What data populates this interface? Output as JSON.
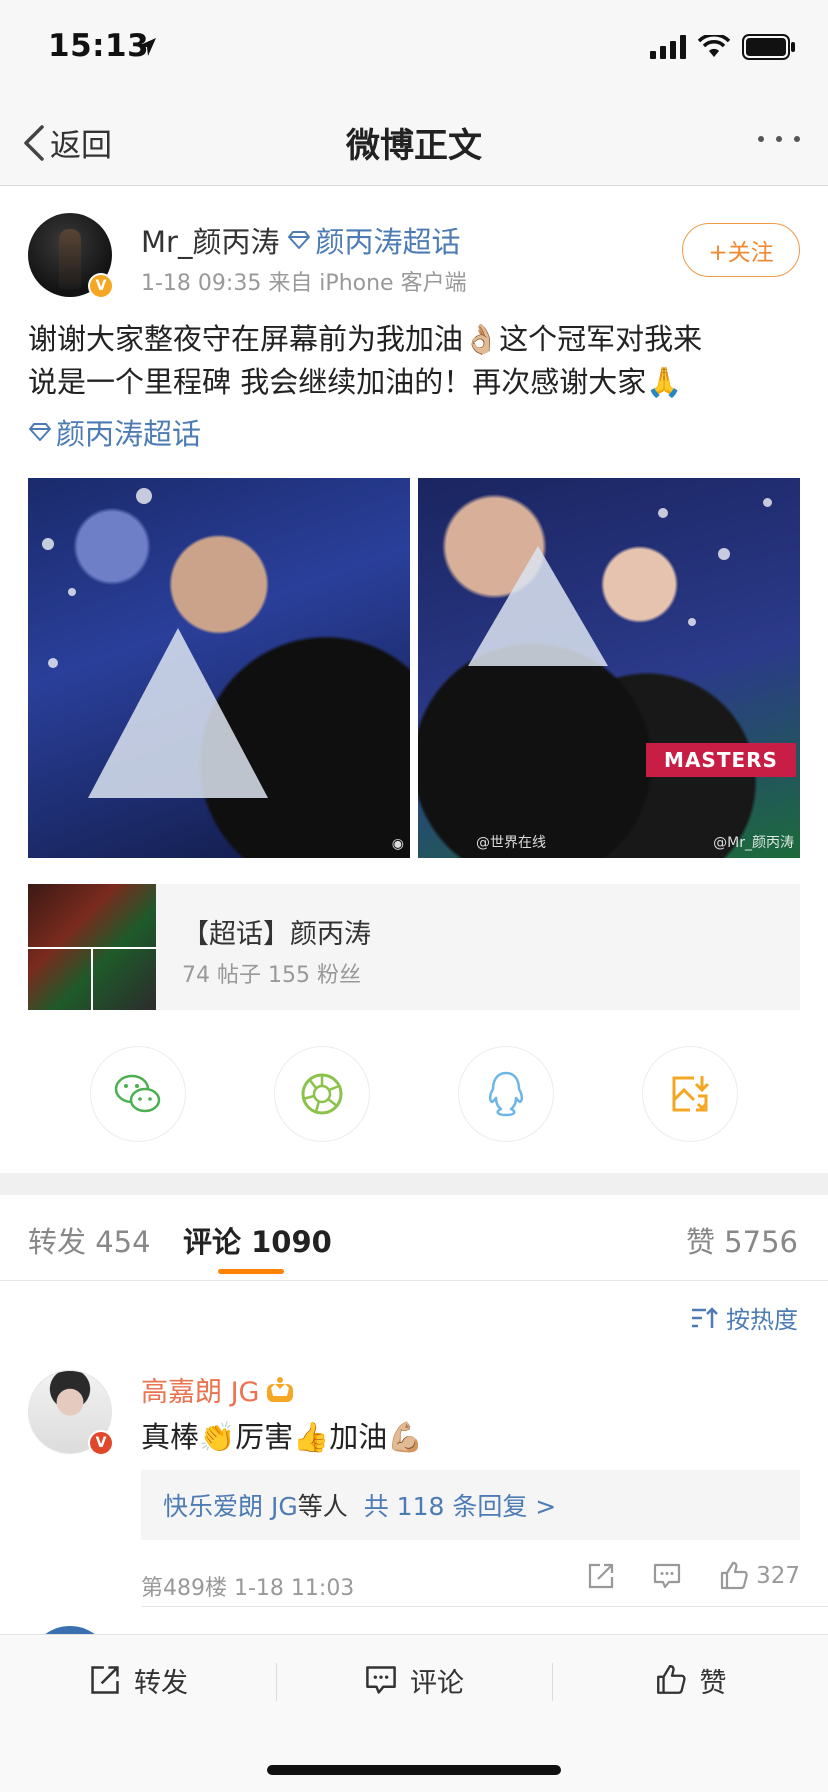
{
  "status_bar": {
    "time": "15:13"
  },
  "nav": {
    "back_label": "返回",
    "title": "微博正文"
  },
  "post": {
    "author": "Mr_颜丙涛",
    "supertopic": "颜丙涛超话",
    "meta": "1-18 09:35  来自 iPhone 客户端",
    "follow_label": "+关注",
    "text_line1": "谢谢大家整夜守在屏幕前为我加油👌🏼这个冠军对我来",
    "text_line2": "说是一个里程碑 我会继续加油的！再次感谢大家🙏",
    "topic_link": "颜丙涛超话",
    "photo2_sign": "MASTERS",
    "photo2_watermark_left": "@世界在线",
    "photo2_watermark_right": "@Mr_颜丙涛"
  },
  "topic_card": {
    "title": "【超话】颜丙涛",
    "stats": "74 帖子 155 粉丝"
  },
  "share_buttons": [
    "wechat-icon",
    "moments-icon",
    "qq-icon",
    "save-image-icon"
  ],
  "tabs": {
    "repost": "转发 454",
    "comments": "评论 1090",
    "likes": "赞 5756"
  },
  "sort_label": "按热度",
  "comment": {
    "user": "高嘉朗 JG",
    "text": "真棒👏厉害👍加油💪🏼",
    "reply_user": "快乐爱朗 JG",
    "reply_mid": "等人",
    "reply_count": "共 118 条回复 >",
    "meta": "第489楼 1-18 11:03",
    "like_count": "327"
  },
  "bottom_bar": {
    "repost": "转发",
    "comment": "评论",
    "like": "赞"
  },
  "colors": {
    "accent_orange": "#ff8200",
    "link_blue": "#4d7cb5",
    "comment_user": "#eb7350"
  }
}
